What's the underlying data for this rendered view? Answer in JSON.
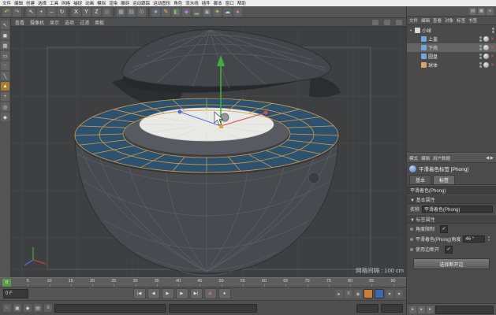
{
  "colors": {
    "selection_blue": "#2d5270",
    "wire_orange": "#cf9a4a",
    "axis_green": "#3fae3f",
    "axis_red": "#d04f4f",
    "axis_blue": "#4f6fd0",
    "accent_orange": "#cf7f35"
  },
  "menubar": {
    "items": [
      "文件",
      "编辑",
      "创建",
      "选择",
      "工具",
      "网格",
      "捕捉",
      "动画",
      "模拟",
      "渲染",
      "雕刻",
      "运动跟踪",
      "运动图形",
      "角色",
      "流水线",
      "插件",
      "脚本",
      "窗口",
      "帮助"
    ]
  },
  "toolbar": {
    "icons": [
      {
        "name": "undo-icon",
        "glyph": "↶",
        "color": "#e8c86a"
      },
      {
        "name": "redo-icon",
        "glyph": "↷",
        "color": "#bdbdbd"
      },
      {
        "name": "sep"
      },
      {
        "name": "live-selection-icon",
        "glyph": "↖",
        "color": "#e0e0e0"
      },
      {
        "name": "move-tool-icon",
        "glyph": "+",
        "color": "#e0e0e0"
      },
      {
        "name": "scale-tool-icon",
        "glyph": "↔",
        "color": "#e0e0e0"
      },
      {
        "name": "rotate-tool-icon",
        "glyph": "↻",
        "color": "#e0e0e0"
      },
      {
        "name": "sep"
      },
      {
        "name": "x-axis-lock-icon",
        "glyph": "X",
        "color": "#f0f0f0"
      },
      {
        "name": "y-axis-lock-icon",
        "glyph": "Y",
        "color": "#f0f0f0"
      },
      {
        "name": "z-axis-lock-icon",
        "glyph": "Z",
        "color": "#f0f0f0"
      },
      {
        "name": "coordinate-system-icon",
        "glyph": "◎",
        "color": "#7ab0d8"
      },
      {
        "name": "sep"
      },
      {
        "name": "render-view-icon",
        "glyph": "▦",
        "color": "#aab8c4"
      },
      {
        "name": "render-picture-viewer-icon",
        "glyph": "▤",
        "color": "#aab8c4"
      },
      {
        "name": "render-settings-icon",
        "glyph": "⊙",
        "color": "#aab8c4"
      },
      {
        "name": "sep"
      },
      {
        "name": "add-cube-icon",
        "glyph": "■",
        "color": "#6fa7d8"
      },
      {
        "name": "add-spline-icon",
        "glyph": "✎",
        "color": "#e0c060"
      },
      {
        "name": "add-generator-icon",
        "glyph": "◧",
        "color": "#7ac07a"
      },
      {
        "name": "add-deformer-icon",
        "glyph": "◆",
        "color": "#b07ad0"
      },
      {
        "name": "add-floor-icon",
        "glyph": "▂",
        "color": "#8ab08a"
      },
      {
        "name": "add-camera-icon",
        "glyph": "▣",
        "color": "#9ab0c0"
      },
      {
        "name": "add-light-icon",
        "glyph": "☀",
        "color": "#e0d070"
      },
      {
        "name": "add-sky-icon",
        "glyph": "☁",
        "color": "#c8d4e0"
      },
      {
        "name": "add-material-icon",
        "glyph": "●",
        "color": "#d89090"
      }
    ]
  },
  "left_toolbar": {
    "icons": [
      {
        "name": "live-selection-icon",
        "glyph": "↖"
      },
      {
        "name": "model-mode-icon",
        "glyph": "◼"
      },
      {
        "name": "texture-mode-icon",
        "glyph": "▦"
      },
      {
        "name": "workplane-mode-icon",
        "glyph": "▭"
      },
      {
        "name": "points-mode-icon",
        "glyph": "∵"
      },
      {
        "name": "edges-mode-icon",
        "glyph": "╲"
      },
      {
        "name": "polygons-mode-icon",
        "glyph": "▲",
        "active": true
      },
      {
        "name": "enable-axis-icon",
        "glyph": "+"
      },
      {
        "name": "viewport-solo-icon",
        "glyph": "◎"
      },
      {
        "name": "enable-snap-icon",
        "glyph": "◆"
      }
    ]
  },
  "viewport": {
    "menu": [
      "查看",
      "摄像机",
      "显示",
      "选项",
      "过滤",
      "面板"
    ],
    "grid_label": "网格间隔 : 100 cm"
  },
  "objects_panel": {
    "menu": [
      "文件",
      "编辑",
      "查看",
      "对象",
      "标签",
      "书签"
    ],
    "items": [
      {
        "label": "小球",
        "depth": 0,
        "expander": "▾",
        "icon_color": "#d8d8d8",
        "selected": false,
        "has_tags": false
      },
      {
        "label": "上盖",
        "depth": 1,
        "expander": "",
        "icon_color": "#6fa7d8",
        "selected": false,
        "has_tags": true
      },
      {
        "label": "下壳",
        "depth": 1,
        "expander": "",
        "icon_color": "#6fa7d8",
        "selected": true,
        "has_tags": true
      },
      {
        "label": "圆盘",
        "depth": 1,
        "expander": "",
        "icon_color": "#6fa7d8",
        "selected": false,
        "has_tags": true
      },
      {
        "label": "球体",
        "depth": 1,
        "expander": "",
        "icon_color": "#d8a36f",
        "selected": false,
        "has_tags": true
      }
    ]
  },
  "attributes_panel": {
    "menu": [
      "模式",
      "编辑",
      "用户数据"
    ],
    "nav": "◀ ▶",
    "title": "平滑着色标签 [Phong]",
    "tabs": [
      "基本",
      "标签"
    ],
    "section": "平滑着色(Phong)",
    "group_basic": "▼ 基本属性",
    "group_tag": "▼ 标签属性",
    "name_label": "名称",
    "name_value": "平滑着色(Phong)",
    "rows": [
      {
        "label": "角度限制",
        "check": "✓"
      },
      {
        "label": "平滑着色(Phong)角度",
        "value": "46 °"
      },
      {
        "label": "使用边断开",
        "check": "✓"
      }
    ],
    "button": "选择断开边"
  },
  "timeline": {
    "playhead": "0",
    "ticks": [
      5,
      10,
      15,
      20,
      25,
      30,
      35,
      40,
      45,
      50,
      55,
      60,
      65,
      70,
      75,
      80,
      85,
      90
    ]
  },
  "transport": {
    "frame_field": "0 F",
    "buttons": [
      {
        "name": "goto-start-button",
        "glyph": "|◀"
      },
      {
        "name": "prev-key-button",
        "glyph": "◀"
      },
      {
        "name": "play-button",
        "glyph": "▶"
      },
      {
        "name": "next-key-button",
        "glyph": "▶"
      },
      {
        "name": "goto-end-button",
        "glyph": "▶|"
      },
      {
        "name": "record-key-button",
        "glyph": "◉",
        "color": "#d87070"
      },
      {
        "name": "autokey-button",
        "glyph": "●",
        "color": "#e0e0e0"
      }
    ],
    "swatches": [
      "#cf7f35",
      "#3e68a8"
    ],
    "right_icons": [
      {
        "name": "solver-icon",
        "glyph": "▸"
      },
      {
        "name": "options-icon",
        "glyph": "≡"
      },
      {
        "name": "magnet-icon",
        "glyph": "◈"
      }
    ]
  },
  "statusbar": {
    "icons": [
      {
        "name": "new-material-icon",
        "glyph": "✎",
        "color": "#d07070"
      },
      {
        "name": "edit-material-icon",
        "glyph": "▣",
        "color": "#cccccc"
      },
      {
        "name": "function-icon",
        "glyph": "◆",
        "color": "#cccccc"
      },
      {
        "name": "list-icon",
        "glyph": "▤",
        "color": "#cccccc"
      },
      {
        "name": "menu-icon",
        "glyph": "≡",
        "color": "#cccccc"
      }
    ]
  },
  "right_panel": {
    "header_icons": [
      {
        "name": "layout-icon",
        "glyph": "▤"
      },
      {
        "name": "content-browser-icon",
        "glyph": "▦"
      },
      {
        "name": "panel-settings-icon",
        "glyph": "≡"
      }
    ]
  }
}
